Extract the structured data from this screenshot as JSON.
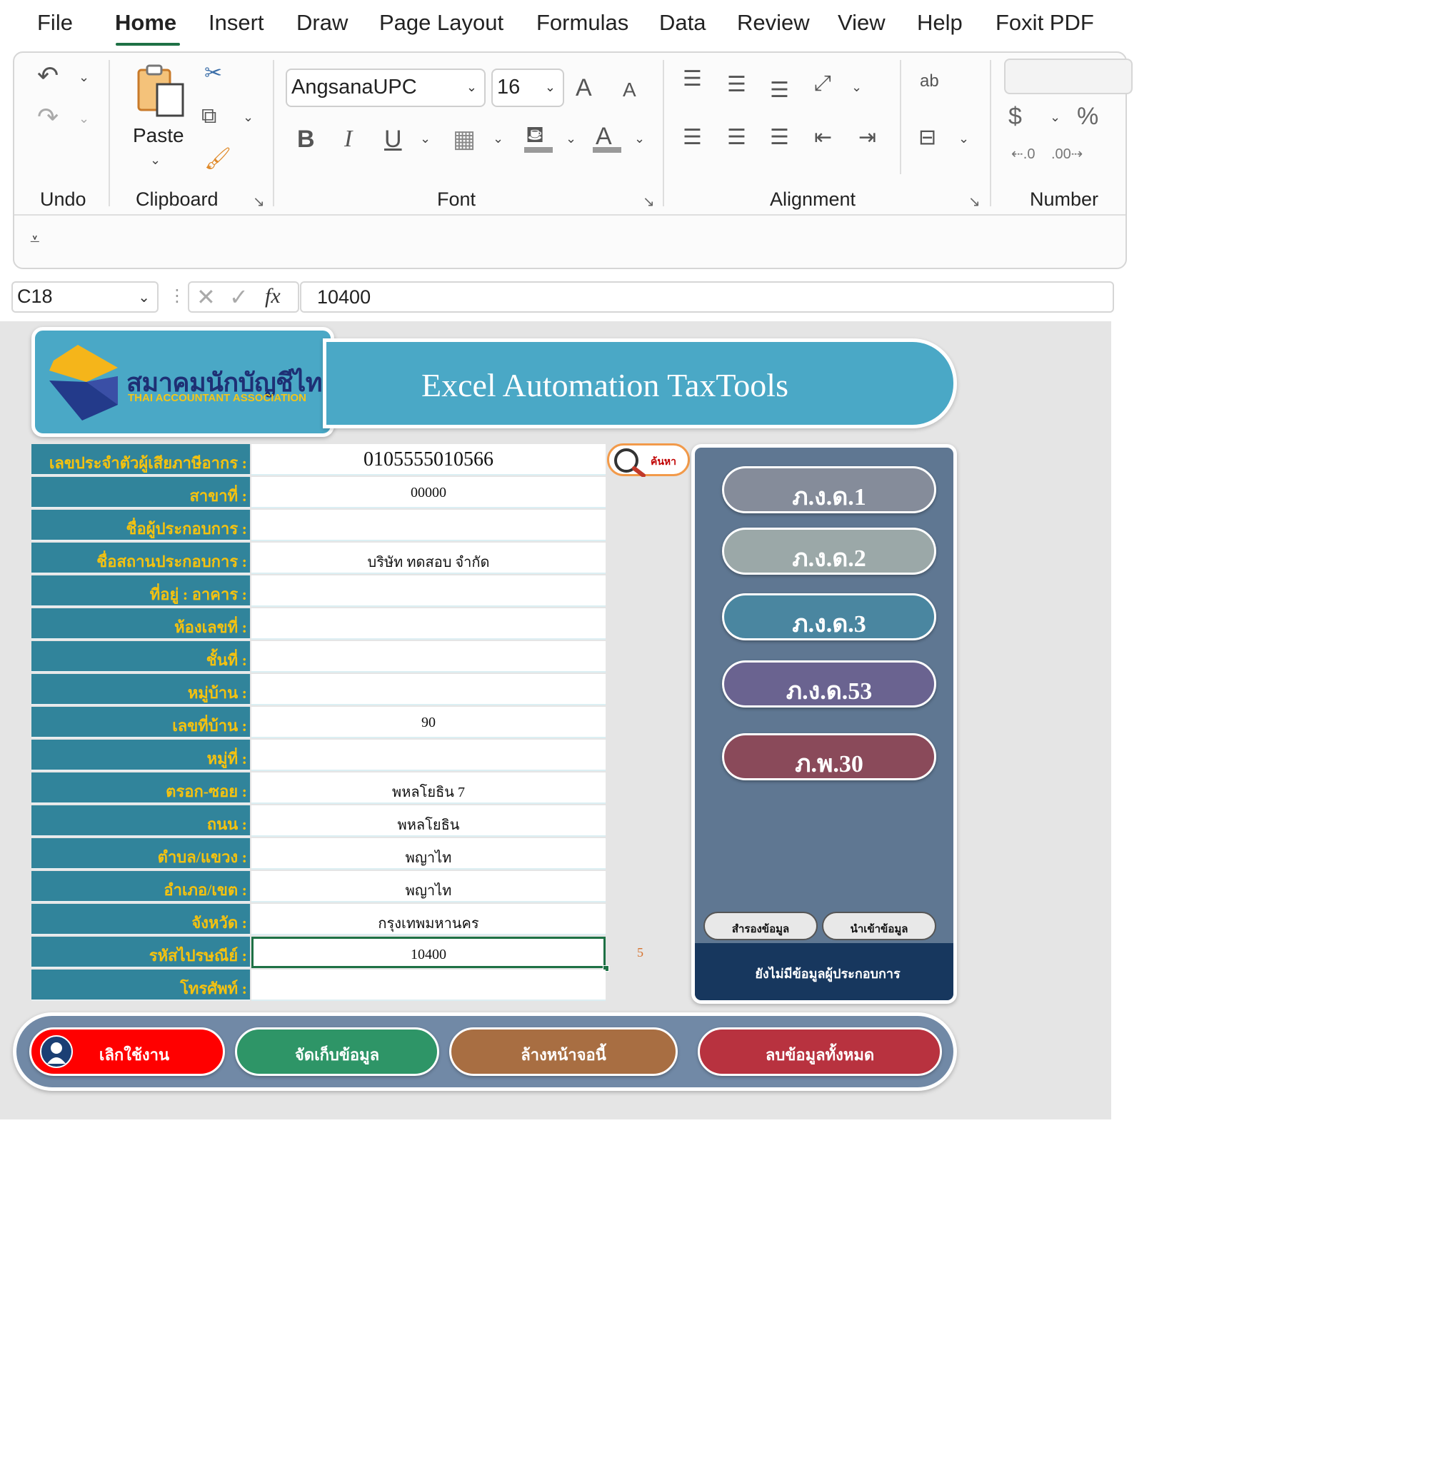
{
  "menu": {
    "tabs": [
      "File",
      "Home",
      "Insert",
      "Draw",
      "Page Layout",
      "Formulas",
      "Data",
      "Review",
      "View",
      "Help",
      "Foxit PDF"
    ],
    "active": "Home"
  },
  "ribbon": {
    "groups": {
      "undo": "Undo",
      "clipboard": "Clipboard",
      "font": "Font",
      "alignment": "Alignment",
      "number": "Number"
    },
    "paste_label": "Paste",
    "font_name": "AngsanaUPC",
    "font_size": "16",
    "bold": "B",
    "italic": "I",
    "underline": "U",
    "currency": "$",
    "percent": "%",
    "wrap": "ab",
    "grow_font": "A",
    "shrink_font": "A",
    "font_color": "A"
  },
  "formula_bar": {
    "cell_ref": "C18",
    "fx": "fx",
    "value": "10400"
  },
  "sheet": {
    "logo": {
      "thai_name": "สมาคมนักบัญชีไทย",
      "english_name": "THAI ACCOUNTANT ASSOCIATION"
    },
    "title": "Excel Automation TaxTools",
    "search_label": "ค้นหา",
    "stray_value": "5",
    "form_rows": [
      {
        "label": "เลขประจำตัวผู้เสียภาษีอากร :",
        "value": "0105555010566"
      },
      {
        "label": "สาขาที่ :",
        "value": "00000"
      },
      {
        "label": "ชื่อผู้ประกอบการ :",
        "value": ""
      },
      {
        "label": "ชื่อสถานประกอบการ :",
        "value": "บริษัท ทดสอบ จำกัด"
      },
      {
        "label": "ที่อยู่ : อาคาร :",
        "value": ""
      },
      {
        "label": "ห้องเลขที่ :",
        "value": ""
      },
      {
        "label": "ชั้นที่ :",
        "value": ""
      },
      {
        "label": "หมู่บ้าน :",
        "value": ""
      },
      {
        "label": "เลขที่บ้าน :",
        "value": "90"
      },
      {
        "label": "หมู่ที่ :",
        "value": ""
      },
      {
        "label": "ตรอก-ซอย :",
        "value": "พหลโยธิน 7"
      },
      {
        "label": "ถนน :",
        "value": "พหลโยธิน"
      },
      {
        "label": "ตำบล/แขวง :",
        "value": "พญาไท"
      },
      {
        "label": "อำเภอ/เขต :",
        "value": "พญาไท"
      },
      {
        "label": "จังหวัด :",
        "value": "กรุงเทพมหานคร"
      },
      {
        "label": "รหัสไปรษณีย์ :",
        "value": "10400"
      },
      {
        "label": "โทรศัพท์ :",
        "value": ""
      }
    ],
    "forms_panel": {
      "buttons": [
        {
          "label": "ภ.ง.ด.1",
          "color": "#858c9a"
        },
        {
          "label": "ภ.ง.ด.2",
          "color": "#9ba8a8"
        },
        {
          "label": "ภ.ง.ด.3",
          "color": "#4a86a0"
        },
        {
          "label": "ภ.ง.ด.53",
          "color": "#6a6390"
        },
        {
          "label": "ภ.พ.30",
          "color": "#8a4a5a"
        }
      ],
      "backup_label": "สำรองข้อมูล",
      "import_label": "นำเข้าข้อมูล",
      "status": "ยังไม่มีข้อมูลผู้ประกอบการ"
    },
    "actions": [
      {
        "label": "เลิกใช้งาน",
        "color": "#ff0000"
      },
      {
        "label": "จัดเก็บข้อมูล",
        "color": "#2e9567"
      },
      {
        "label": "ล้างหน้าจอนี้",
        "color": "#a86e42"
      },
      {
        "label": "ลบข้อมูลทั้งหมด",
        "color": "#b8323f"
      }
    ]
  }
}
